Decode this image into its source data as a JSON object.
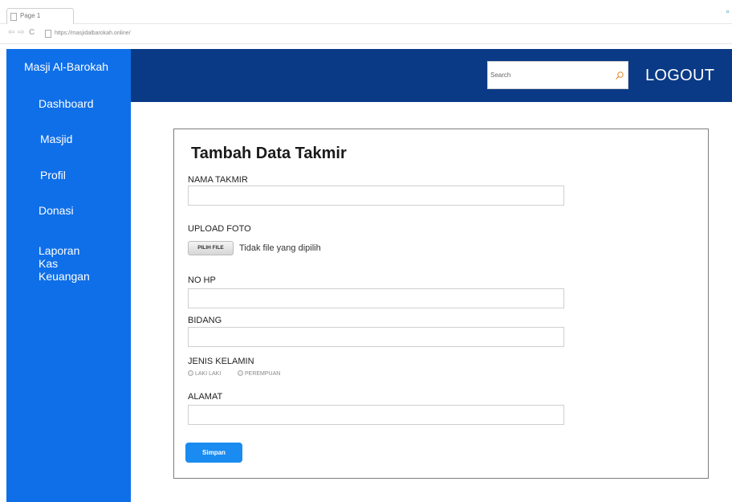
{
  "browser": {
    "tab_title": "Page 1",
    "url": "https://masjidalbarokah.online/"
  },
  "sidebar": {
    "brand": "Masji Al-Barokah",
    "items": [
      {
        "label": "Dashboard"
      },
      {
        "label": "Masjid"
      },
      {
        "label": "Profil"
      },
      {
        "label": "Donasi"
      },
      {
        "label": "Laporan\nKas\nKeuangan"
      }
    ]
  },
  "header": {
    "search_placeholder": "Search",
    "logout_label": "LOGOUT"
  },
  "form": {
    "title": "Tambah Data Takmir",
    "nama_label": "NAMA TAKMIR",
    "foto_label": "UPLOAD FOTO",
    "file_button": "PILIH FILE",
    "file_status": "Tidak file yang dipilih",
    "hp_label": "NO HP",
    "bidang_label": "BIDANG",
    "jk_label": "JENIS KELAMIN",
    "jk_options": [
      "LAKI LAKI",
      "PEREMPUAN"
    ],
    "alamat_label": "ALAMAT",
    "submit_label": "Simpan"
  },
  "colors": {
    "sidebar_bg": "#0f6fe8",
    "header_bg": "#0a3a86",
    "button_bg": "#1a8bf0"
  }
}
